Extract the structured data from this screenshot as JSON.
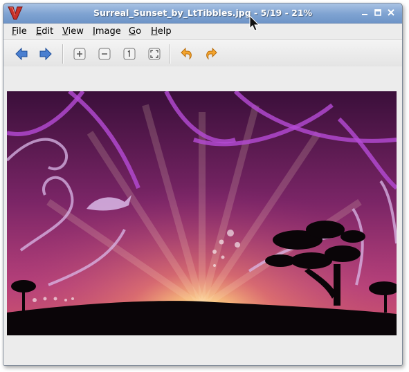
{
  "window": {
    "title": "Surreal_Sunset_by_LtTibbles.jpg - 5/19 - 21%",
    "app_icon": "viewer-v-logo-icon",
    "controls": [
      "minimize-icon",
      "maximize-icon",
      "close-icon"
    ]
  },
  "menu": {
    "items": [
      {
        "label": "File",
        "mnemonic": "F",
        "rest": "ile"
      },
      {
        "label": "Edit",
        "mnemonic": "E",
        "rest": "dit"
      },
      {
        "label": "View",
        "mnemonic": "V",
        "rest": "iew"
      },
      {
        "label": "Image",
        "mnemonic": "I",
        "rest": "mage"
      },
      {
        "label": "Go",
        "mnemonic": "G",
        "rest": "o"
      },
      {
        "label": "Help",
        "mnemonic": "H",
        "rest": "elp"
      }
    ]
  },
  "toolbar": {
    "buttons": [
      {
        "name": "previous-image-button",
        "icon": "arrow-left-icon"
      },
      {
        "name": "next-image-button",
        "icon": "arrow-right-icon"
      },
      {
        "name": "zoom-in-button",
        "icon": "zoom-in-icon"
      },
      {
        "name": "zoom-out-button",
        "icon": "zoom-out-icon"
      },
      {
        "name": "zoom-normal-button",
        "icon": "zoom-100-icon"
      },
      {
        "name": "zoom-fit-button",
        "icon": "zoom-fit-icon"
      },
      {
        "name": "rotate-left-button",
        "icon": "rotate-left-icon"
      },
      {
        "name": "rotate-right-button",
        "icon": "rotate-right-icon"
      }
    ]
  },
  "image": {
    "description_icon": "surreal-sunset-photo",
    "colors": {
      "sky_top": "#3a0f3a",
      "sky_mid": "#9a2f7a",
      "glow": "#ffd98a",
      "ground": "#0a0508"
    }
  },
  "colors": {
    "titlebar": "#7ea2d1",
    "window_bg": "#ececec",
    "accent_blue": "#3f74c4",
    "accent_orange": "#f2a02b"
  }
}
